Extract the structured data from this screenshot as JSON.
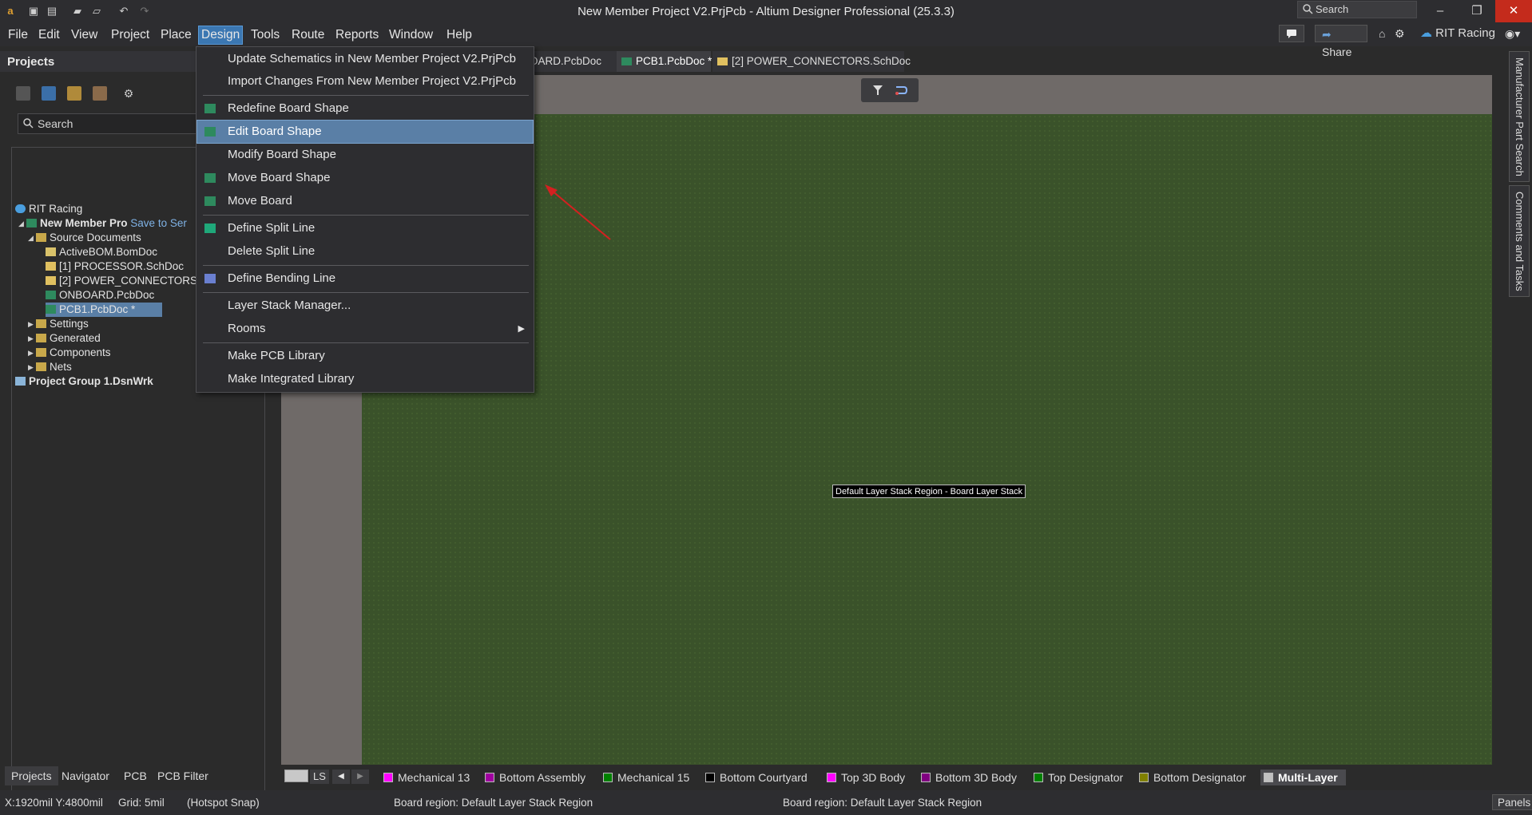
{
  "window": {
    "title": "New Member Project V2.PrjPcb - Altium Designer Professional (25.3.3)",
    "search_placeholder": "Search",
    "min": "–",
    "max": "❐",
    "close": "✕"
  },
  "menubar": {
    "items": [
      "File",
      "Edit",
      "View",
      "Project",
      "Place",
      "Design",
      "Tools",
      "Route",
      "Reports",
      "Window",
      "Help"
    ],
    "active": "Design",
    "share": "Share",
    "account": "RIT Racing"
  },
  "projects_panel": {
    "title": "Projects",
    "search_placeholder": "Search",
    "tree": {
      "workspace": "RIT Racing",
      "project": "New Member Pro",
      "save_hint": "Save to Ser",
      "source_documents": "Source Documents",
      "docs": [
        "ActiveBOM.BomDoc",
        "[1] PROCESSOR.SchDoc",
        "[2] POWER_CONNECTORS",
        "ONBOARD.PcbDoc",
        "PCB1.PcbDoc *"
      ],
      "folders": [
        "Settings",
        "Generated",
        "Components",
        "Nets"
      ],
      "group": "Project Group 1.DsnWrk"
    },
    "bottom_tabs": [
      "Projects",
      "Navigator",
      "PCB",
      "PCB Filter"
    ]
  },
  "doc_tabs": [
    "BOARD.PcbDoc",
    "PCB1.PcbDoc *",
    "[2] POWER_CONNECTORS.SchDoc"
  ],
  "canvas": {
    "board_label": "Default Layer Stack Region - Board Layer Stack"
  },
  "right_panels": [
    "Manufacturer Part Search",
    "Comments and Tasks"
  ],
  "design_menu": {
    "items": [
      {
        "label": "Update Schematics in New Member Project V2.PrjPcb"
      },
      {
        "label": "Import Changes From New Member Project V2.PrjPcb"
      },
      {
        "label": "Redefine Board Shape"
      },
      {
        "label": "Edit Board Shape"
      },
      {
        "label": "Modify Board Shape"
      },
      {
        "label": "Move Board Shape"
      },
      {
        "label": "Move Board"
      },
      {
        "label": "Define Split Line"
      },
      {
        "label": "Delete Split Line"
      },
      {
        "label": "Define Bending Line"
      },
      {
        "label": "Layer Stack Manager..."
      },
      {
        "label": "Rooms"
      },
      {
        "label": "Make PCB Library"
      },
      {
        "label": "Make Integrated Library"
      }
    ],
    "highlighted": "Edit Board Shape"
  },
  "layer_bar": {
    "ls": "LS",
    "layers": [
      {
        "name": "Mechanical 13",
        "color": "#ff00ff"
      },
      {
        "name": "Bottom Assembly",
        "color": "#a000a0"
      },
      {
        "name": "Mechanical 15",
        "color": "#008000"
      },
      {
        "name": "Bottom Courtyard",
        "color": "#000000"
      },
      {
        "name": "Top 3D Body",
        "color": "#ff00ff"
      },
      {
        "name": "Bottom 3D Body",
        "color": "#800080"
      },
      {
        "name": "Top Designator",
        "color": "#008000"
      },
      {
        "name": "Bottom Designator",
        "color": "#808000"
      },
      {
        "name": "Multi-Layer",
        "color": "#c0c0c0"
      }
    ],
    "active": "Multi-Layer"
  },
  "status": {
    "coords": "X:1920mil Y:4800mil",
    "grid": "Grid: 5mil",
    "snap": "(Hotspot Snap)",
    "region1": "Board region: Default Layer Stack Region",
    "region2": "Board region: Default Layer Stack Region",
    "panels": "Panels"
  }
}
